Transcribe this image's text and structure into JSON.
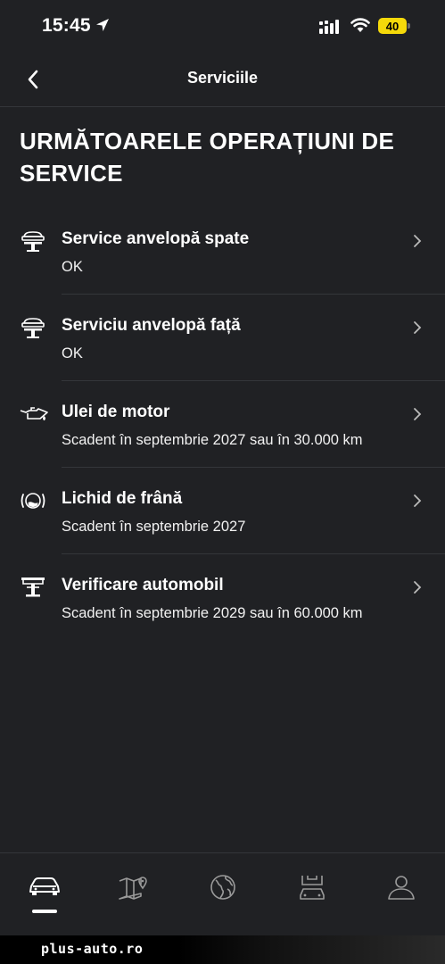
{
  "status_bar": {
    "time": "15:45",
    "battery_level": "40",
    "icons": [
      "location-arrow-icon",
      "signal-icon",
      "wifi-icon",
      "battery-icon"
    ]
  },
  "header": {
    "title": "Serviciile",
    "back_icon": "chevron-left-icon"
  },
  "section": {
    "title": "URMĂTOARELE OPERAȚIUNI DE SERVICE"
  },
  "services": [
    {
      "icon": "car-lift-icon",
      "title": "Service anvelopă spate",
      "status": "OK"
    },
    {
      "icon": "car-lift-icon",
      "title": "Serviciu anvelopă față",
      "status": "OK"
    },
    {
      "icon": "oil-can-icon",
      "title": "Ulei de motor",
      "status": "Scadent în septembrie 2027 sau în 30.000 km"
    },
    {
      "icon": "brake-fluid-icon",
      "title": "Lichid de frână",
      "status": "Scadent în septembrie 2027"
    },
    {
      "icon": "vehicle-check-icon",
      "title": "Verificare automobil",
      "status": "Scadent în septembrie 2029 sau în 60.000 km"
    }
  ],
  "bottom_nav": {
    "tabs": [
      "car-icon",
      "map-pin-icon",
      "globe-icon",
      "car-service-icon",
      "profile-icon"
    ],
    "active_tab": 0
  },
  "footer": {
    "watermark": "plus-auto.ro"
  },
  "colors": {
    "background": "#202124",
    "divider": "#34363a",
    "battery": "#f5d90a",
    "text": "#ffffff"
  }
}
